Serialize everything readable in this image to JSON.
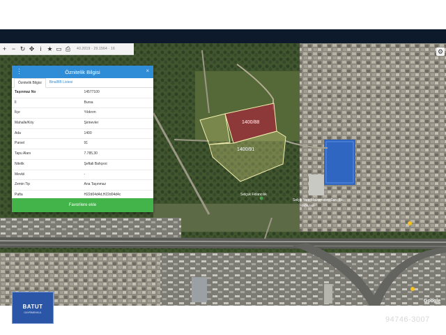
{
  "toolbar": {
    "buttons": [
      {
        "name": "plus-icon",
        "glyph": "+"
      },
      {
        "name": "minus-icon",
        "glyph": "−"
      },
      {
        "name": "refresh-icon",
        "glyph": "↻"
      },
      {
        "name": "pan-icon",
        "glyph": "✥"
      },
      {
        "name": "info-icon",
        "glyph": "i"
      },
      {
        "name": "star-icon",
        "glyph": "★"
      },
      {
        "name": "ruler-icon",
        "glyph": "▭"
      },
      {
        "name": "print-icon",
        "glyph": "⎙"
      }
    ],
    "coordinates": "40.2019 · 29.1564 · 16"
  },
  "settings_glyph": "⚙",
  "panel": {
    "title": "Öznitelik Bilgisi",
    "menu_glyph": "⋮",
    "close_glyph": "×",
    "tabs": [
      {
        "label": "Öznitelik Bilgisi",
        "active": true
      },
      {
        "label": "Bina/BB Listesi",
        "active": false
      }
    ],
    "rows": [
      {
        "key": "Taşınmaz No",
        "value": "14577100"
      },
      {
        "key": "İl",
        "value": "Bursa"
      },
      {
        "key": "İlçe",
        "value": "Yıldırım"
      },
      {
        "key": "Mahalle/Köy",
        "value": "Şirinevler"
      },
      {
        "key": "Ada",
        "value": "1400"
      },
      {
        "key": "Parsel",
        "value": "91"
      },
      {
        "key": "Tapu Alanı",
        "value": "7.785,30"
      },
      {
        "key": "Nitelik",
        "value": "Şeftali Bahçesi"
      },
      {
        "key": "Mevkii",
        "value": "-"
      },
      {
        "key": "Zemin Tip",
        "value": "Ana Taşınmaz"
      },
      {
        "key": "Pafta",
        "value": "H22d04d4d,H22d04d4c"
      }
    ],
    "favorite_button": "Favorilere ekle"
  },
  "map": {
    "parcel_labels": [
      "1400/88",
      "1400/91"
    ],
    "place_labels": [
      "Selçuk Fidancılık",
      "Selçik Yapı Malzemeleri San. Tic.",
      "Mağazası"
    ],
    "colors": {
      "selected_parcel": "#9b2c3a",
      "adjacent_parcel": "#e8e48a",
      "outline": "#f4f0b0"
    }
  },
  "logo": {
    "text": "BATUT",
    "sub": "GAYRİMENKUL"
  },
  "google_mark": "Google",
  "watermark": "94746-3007"
}
